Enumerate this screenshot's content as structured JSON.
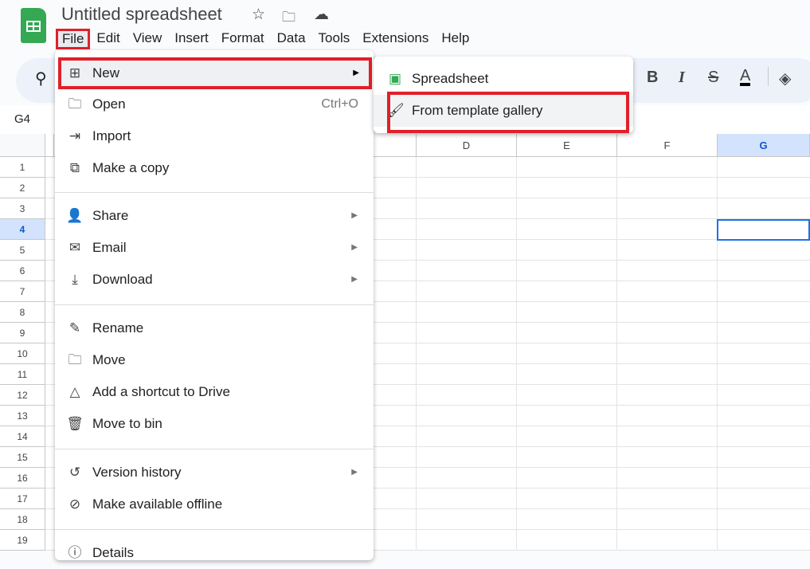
{
  "app": {
    "title": "Untitled spreadsheet",
    "name_box": "G4"
  },
  "menubar": [
    "File",
    "Edit",
    "View",
    "Insert",
    "Format",
    "Data",
    "Tools",
    "Extensions",
    "Help"
  ],
  "toolbar": {
    "bold": "B",
    "italic": "I",
    "strike": "S",
    "text_color": "A"
  },
  "columns": [
    "D",
    "E",
    "F",
    "G"
  ],
  "rows": [
    "1",
    "2",
    "3",
    "4",
    "5",
    "6",
    "7",
    "8",
    "9",
    "10",
    "11",
    "12",
    "13",
    "14",
    "15",
    "16",
    "17",
    "18",
    "19"
  ],
  "selected_cell": "G4",
  "file_menu": [
    {
      "label": "New",
      "icon": "new-plus-icon",
      "submenu": true
    },
    {
      "label": "Open",
      "icon": "folder-icon",
      "shortcut": "Ctrl+O"
    },
    {
      "label": "Import",
      "icon": "import-icon"
    },
    {
      "label": "Make a copy",
      "icon": "copy-icon"
    },
    {
      "label": "Share",
      "icon": "share-icon",
      "submenu": true
    },
    {
      "label": "Email",
      "icon": "email-icon",
      "submenu": true
    },
    {
      "label": "Download",
      "icon": "download-icon",
      "submenu": true
    },
    {
      "label": "Rename",
      "icon": "rename-icon"
    },
    {
      "label": "Move",
      "icon": "move-icon"
    },
    {
      "label": "Add a shortcut to Drive",
      "icon": "drive-shortcut-icon"
    },
    {
      "label": "Move to bin",
      "icon": "trash-icon"
    },
    {
      "label": "Version history",
      "icon": "history-icon",
      "submenu": true
    },
    {
      "label": "Make available offline",
      "icon": "offline-icon"
    },
    {
      "label": "Details",
      "icon": "info-icon"
    }
  ],
  "new_submenu": [
    {
      "label": "Spreadsheet",
      "icon": "sheets-icon"
    },
    {
      "label": "From template gallery",
      "icon": "template-icon"
    }
  ],
  "colors": {
    "highlight": "#e0202a",
    "sheets_green": "#34a853",
    "selection": "#1a73e8"
  }
}
